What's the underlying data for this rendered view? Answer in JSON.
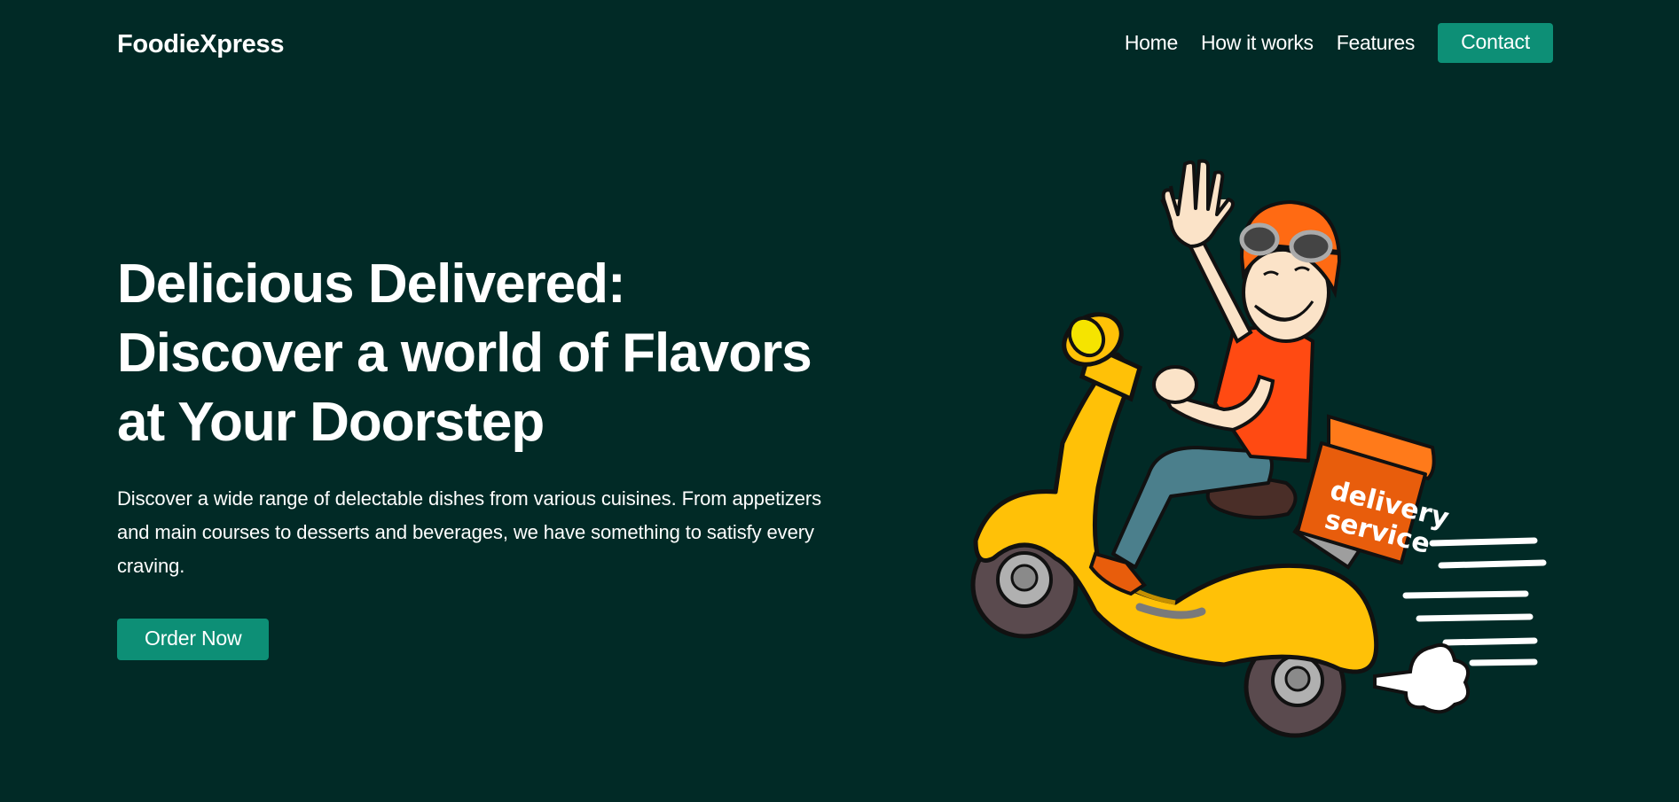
{
  "navbar": {
    "brand": "FoodieXpress",
    "links": [
      "Home",
      "How it works",
      "Features"
    ],
    "contact_label": "Contact"
  },
  "hero": {
    "title_lines": [
      "Delicious Delivered:",
      "Discover a world of Flavors",
      "at Your Doorstep"
    ],
    "description": "Discover a wide range of delectable dishes from various cuisines. From appetizers and main courses to desserts and beverages, we have something to satisfy every craving.",
    "cta_label": "Order Now"
  },
  "illustration": {
    "box_text_line1": "delivery",
    "box_text_line2": "service"
  },
  "colors": {
    "background": "#012a26",
    "accent": "#0d8f76",
    "scooter": "#ffc107",
    "helmet": "#ff6a13",
    "box": "#e85d0c"
  }
}
